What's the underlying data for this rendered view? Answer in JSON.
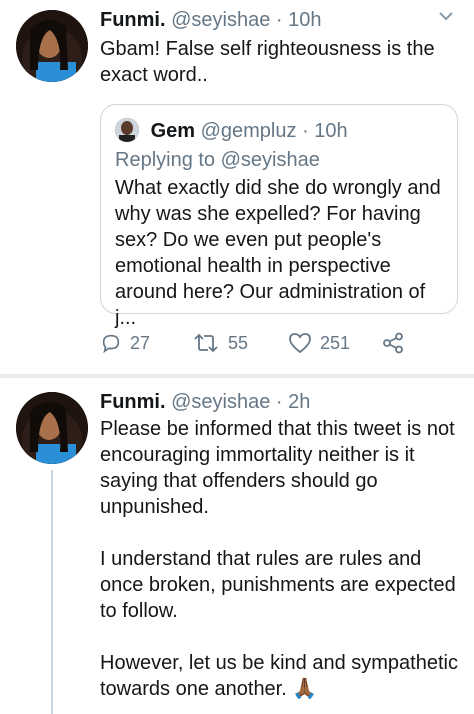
{
  "tweet1": {
    "name": "Funmi.",
    "handle": "@seyishae",
    "dot": "·",
    "time": "10h",
    "text": "Gbam! False self righteousness is the exact word..",
    "quote": {
      "name": "Gem",
      "handle": "@gempluz",
      "dot": "·",
      "time": "10h",
      "replying_prefix": "Replying to",
      "replying_to": "@seyishae",
      "text": "What exactly did she do wrongly and why was she expelled? For having sex? Do we even put people's emotional health in perspective around here? Our administration of j..."
    },
    "actions": {
      "replies": "27",
      "retweets": "55",
      "likes": "251"
    }
  },
  "tweet2": {
    "name": "Funmi.",
    "handle": "@seyishae",
    "dot": "·",
    "time": "2h",
    "paragraphs": [
      "Please be informed that this tweet is not encouraging immortality neither is it saying that offenders should go unpunished.",
      "I understand that rules are rules and once broken, punishments are expected to follow.",
      "However, let us be kind and sympathetic towards one another. 🙏🏾"
    ]
  },
  "icons": {
    "caret": "chevron-down-icon",
    "reply": "speech-bubble-icon",
    "retweet": "retweet-arrows-icon",
    "like": "heart-icon",
    "share": "share-nodes-icon"
  },
  "colors": {
    "text": "#14171a",
    "secondary": "#657786",
    "border": "#ccd6dd",
    "divider": "#e6ecf0"
  }
}
